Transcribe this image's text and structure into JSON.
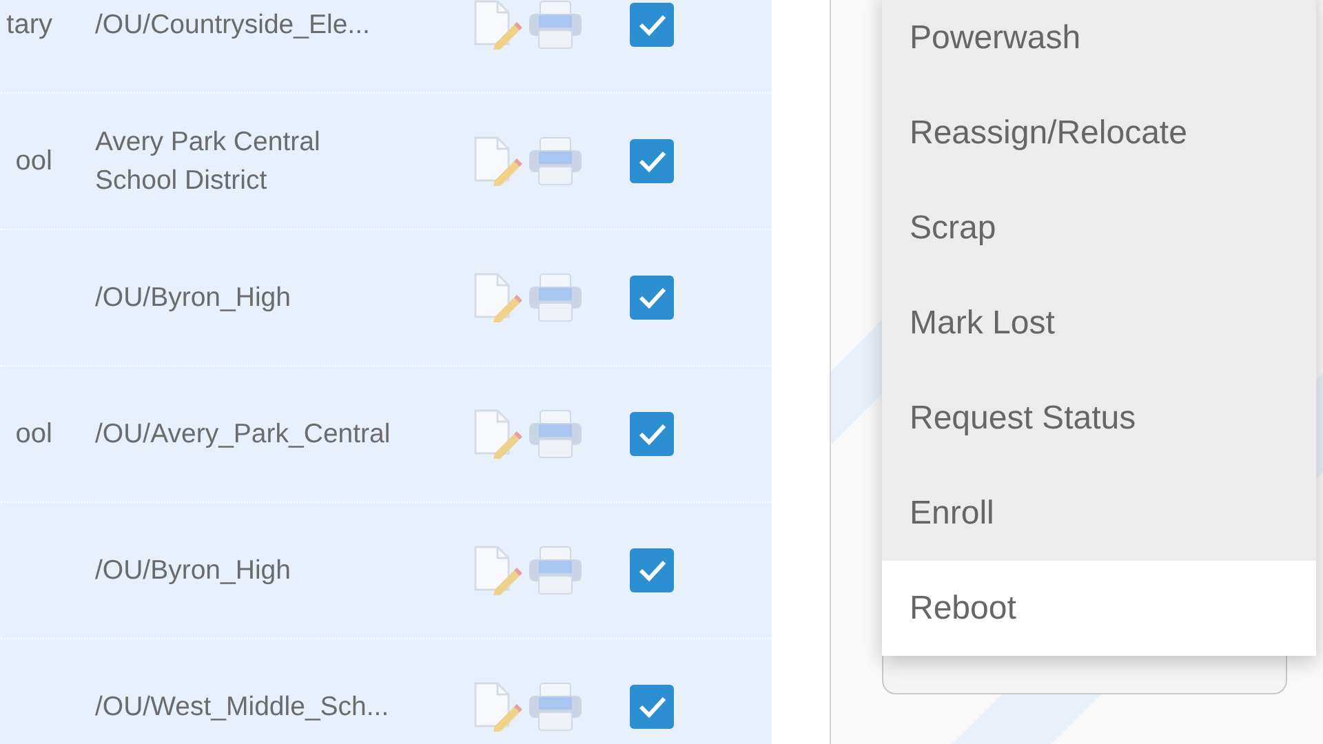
{
  "table": {
    "rows": [
      {
        "column_1": "tary",
        "path": "/OU/Countryside_Ele...",
        "checked": true
      },
      {
        "column_1": "ool",
        "path": "Avery Park Central School District",
        "checked": true
      },
      {
        "column_1": "",
        "path": "/OU/Byron_High",
        "checked": true
      },
      {
        "column_1": "ool",
        "path": "/OU/Avery_Park_Central",
        "checked": true
      },
      {
        "column_1": "",
        "path": "/OU/Byron_High",
        "checked": true
      },
      {
        "column_1": "",
        "path": "/OU/West_Middle_Sch...",
        "checked": true
      }
    ]
  },
  "action_menu": {
    "items": [
      {
        "label": "Powerwash",
        "selected": false
      },
      {
        "label": "Reassign/Relocate",
        "selected": false
      },
      {
        "label": "Scrap",
        "selected": false
      },
      {
        "label": "Mark Lost",
        "selected": false
      },
      {
        "label": "Request Status",
        "selected": false
      },
      {
        "label": "Enroll",
        "selected": false
      },
      {
        "label": "Reboot",
        "selected": true
      }
    ]
  }
}
